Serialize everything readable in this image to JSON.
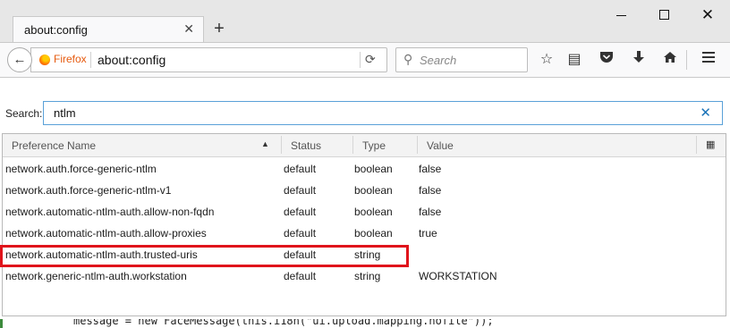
{
  "tab": {
    "title": "about:config"
  },
  "nav": {
    "identity_label": "Firefox",
    "url": "about:config",
    "search_placeholder": "Search",
    "icons": [
      "back-arrow-icon",
      "reload-icon",
      "search-icon",
      "bookmark-star-icon",
      "reading-list-icon",
      "pocket-icon",
      "download-icon",
      "home-icon",
      "hamburger-menu-icon"
    ]
  },
  "page": {
    "search_label": "Search:",
    "search_value": "ntlm",
    "columns": [
      "Preference Name",
      "Status",
      "Type",
      "Value"
    ],
    "rows": [
      {
        "name": "network.auth.force-generic-ntlm",
        "status": "default",
        "type": "boolean",
        "value": "false"
      },
      {
        "name": "network.auth.force-generic-ntlm-v1",
        "status": "default",
        "type": "boolean",
        "value": "false"
      },
      {
        "name": "network.automatic-ntlm-auth.allow-non-fqdn",
        "status": "default",
        "type": "boolean",
        "value": "false"
      },
      {
        "name": "network.automatic-ntlm-auth.allow-proxies",
        "status": "default",
        "type": "boolean",
        "value": "true"
      },
      {
        "name": "network.automatic-ntlm-auth.trusted-uris",
        "status": "default",
        "type": "string",
        "value": ""
      },
      {
        "name": "network.generic-ntlm-auth.workstation",
        "status": "default",
        "type": "string",
        "value": "WORKSTATION"
      }
    ],
    "highlight_color": "#e0141b"
  },
  "background_code": "message = new FaceMessage(this.i18n(\"ui.upload.mapping.nofile\"));"
}
